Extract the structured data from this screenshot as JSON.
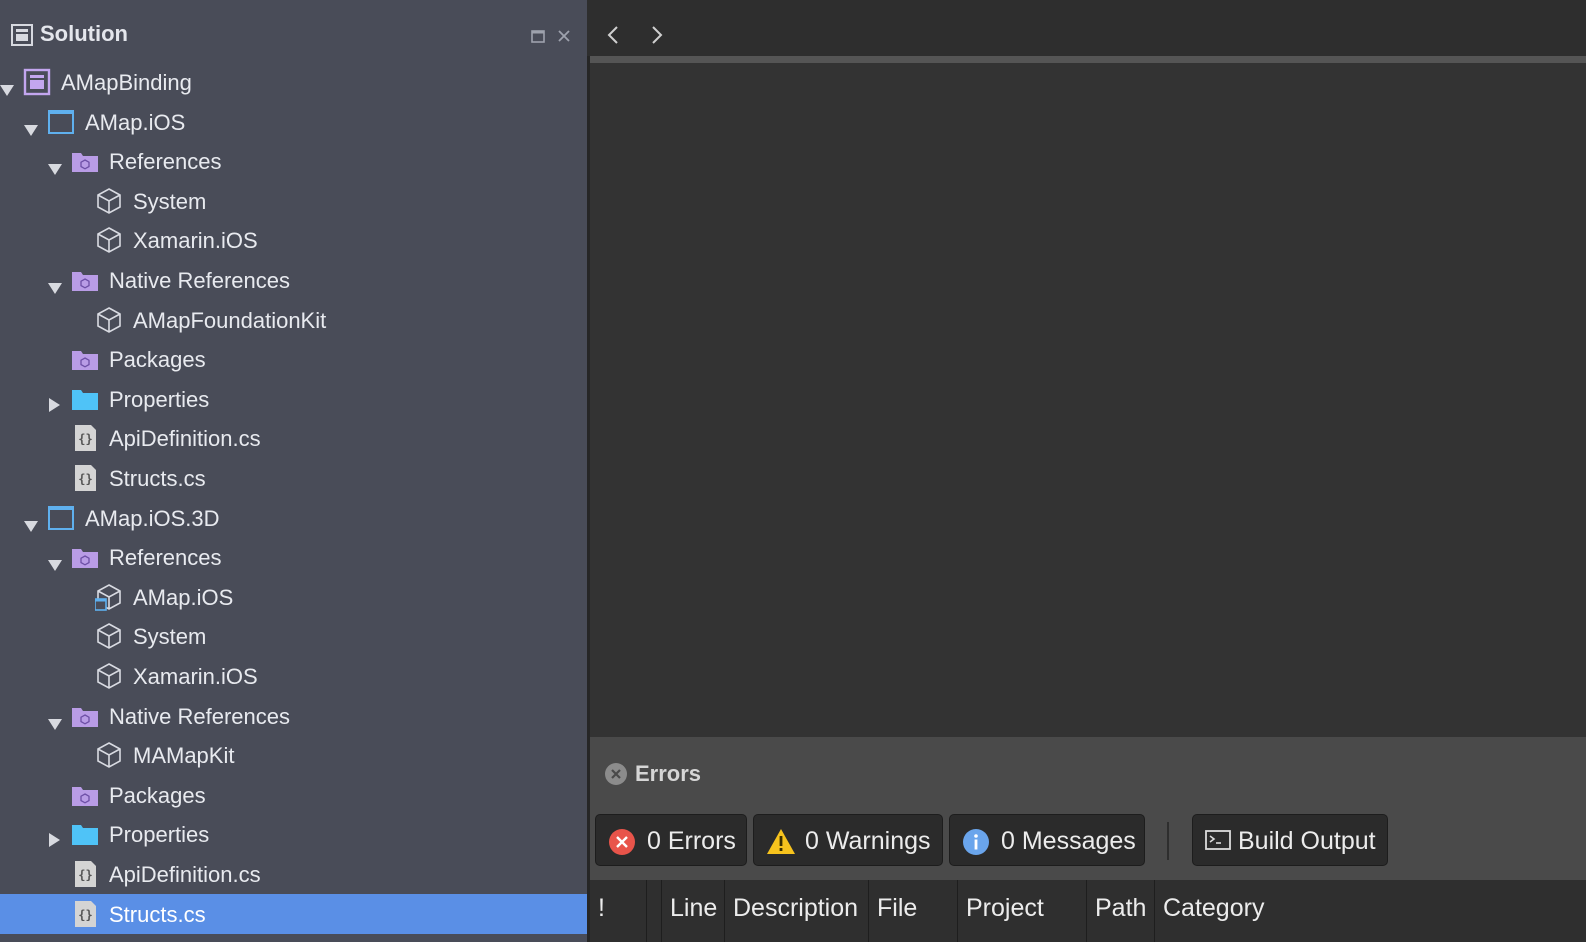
{
  "solution_pad": {
    "title": "Solution",
    "tree": [
      {
        "label": "AMapBinding",
        "icon": "solution-icon",
        "toggle": "expanded",
        "depth": 0
      },
      {
        "label": "AMap.iOS",
        "icon": "project-icon",
        "toggle": "expanded",
        "depth": 1
      },
      {
        "label": "References",
        "icon": "references-folder-icon",
        "toggle": "expanded",
        "depth": 2
      },
      {
        "label": "System",
        "icon": "assembly-icon",
        "toggle": "none",
        "depth": 3
      },
      {
        "label": "Xamarin.iOS",
        "icon": "assembly-icon",
        "toggle": "none",
        "depth": 3
      },
      {
        "label": "Native References",
        "icon": "references-folder-icon",
        "toggle": "expanded",
        "depth": 2
      },
      {
        "label": "AMapFoundationKit",
        "icon": "assembly-icon",
        "toggle": "none",
        "depth": 3
      },
      {
        "label": "Packages",
        "icon": "references-folder-icon",
        "toggle": "none",
        "depth": 2
      },
      {
        "label": "Properties",
        "icon": "folder-icon",
        "toggle": "collapsed",
        "depth": 2
      },
      {
        "label": "ApiDefinition.cs",
        "icon": "csharp-file-icon",
        "toggle": "none",
        "depth": 2
      },
      {
        "label": "Structs.cs",
        "icon": "csharp-file-icon",
        "toggle": "none",
        "depth": 2
      },
      {
        "label": "AMap.iOS.3D",
        "icon": "project-icon",
        "toggle": "expanded",
        "depth": 1
      },
      {
        "label": "References",
        "icon": "references-folder-icon",
        "toggle": "expanded",
        "depth": 2
      },
      {
        "label": "AMap.iOS",
        "icon": "project-reference-icon",
        "toggle": "none",
        "depth": 3
      },
      {
        "label": "System",
        "icon": "assembly-icon",
        "toggle": "none",
        "depth": 3
      },
      {
        "label": "Xamarin.iOS",
        "icon": "assembly-icon",
        "toggle": "none",
        "depth": 3
      },
      {
        "label": "Native References",
        "icon": "references-folder-icon",
        "toggle": "expanded",
        "depth": 2
      },
      {
        "label": "MAMapKit",
        "icon": "assembly-icon",
        "toggle": "none",
        "depth": 3
      },
      {
        "label": "Packages",
        "icon": "references-folder-icon",
        "toggle": "none",
        "depth": 2
      },
      {
        "label": "Properties",
        "icon": "folder-icon",
        "toggle": "collapsed",
        "depth": 2
      },
      {
        "label": "ApiDefinition.cs",
        "icon": "csharp-file-icon",
        "toggle": "none",
        "depth": 2
      },
      {
        "label": "Structs.cs",
        "icon": "csharp-file-icon",
        "toggle": "none",
        "depth": 2,
        "selected": true
      }
    ]
  },
  "errors_pad": {
    "title": "Errors",
    "buttons": {
      "errors": "0 Errors",
      "warnings": "0 Warnings",
      "messages": "0 Messages",
      "build_output": "Build Output"
    },
    "columns": [
      "!",
      "",
      "Line",
      "Description",
      "File",
      "Project",
      "Path",
      "Category"
    ]
  },
  "colors": {
    "sidebar_bg": "#494c58",
    "selection": "#5a8fe6",
    "reference_purple": "#b99ce6",
    "folder_blue": "#4fc3f7",
    "error_red": "#e8544a",
    "warning_yellow": "#f7c31d",
    "info_blue": "#6aa5ec"
  }
}
